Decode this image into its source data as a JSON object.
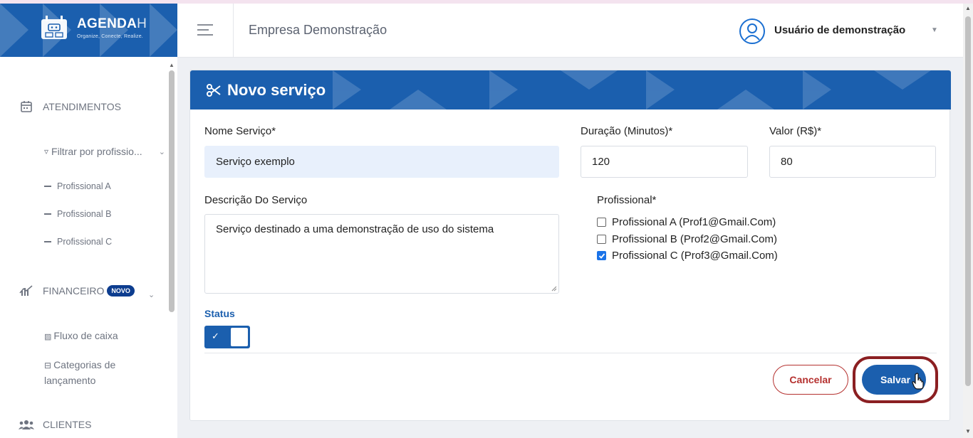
{
  "brand": {
    "name": "AGENDA",
    "name_suffix": "H",
    "tagline": "Organize, Conecte, Realize."
  },
  "header": {
    "company": "Empresa Demonstração",
    "user_name": "Usuário de demonstração"
  },
  "sidebar": {
    "atendimentos": "ATENDIMENTOS",
    "filter": "Filtrar por profissio...",
    "professionals": [
      "Profissional A",
      "Profissional B",
      "Profissional C"
    ],
    "financeiro": "FINANCEIRO",
    "badge_new": "NOVO",
    "fluxo": "Fluxo de caixa",
    "categorias": "Categorias de lançamento",
    "clientes": "CLIENTES"
  },
  "form": {
    "title": "Novo serviço",
    "name_label": "Nome Serviço*",
    "name_value": "Serviço exemplo",
    "duration_label": "Duração (Minutos)*",
    "duration_value": "120",
    "price_label": "Valor (R$)*",
    "price_value": "80",
    "description_label": "Descrição Do Serviço",
    "description_value": "Serviço destinado a uma demonstração de uso do sistema",
    "professional_label": "Profissional*",
    "professional_options": [
      {
        "label": "Profissional A (Prof1@Gmail.Com)",
        "checked": false
      },
      {
        "label": "Profissional B (Prof2@Gmail.Com)",
        "checked": false
      },
      {
        "label": "Profissional C (Prof3@Gmail.Com)",
        "checked": true
      }
    ],
    "status_label": "Status",
    "status_on": true,
    "cancel_label": "Cancelar",
    "save_label": "Salvar"
  },
  "colors": {
    "primary": "#1b5fae",
    "cancel": "#b5312f",
    "highlight": "#8b1f22"
  }
}
